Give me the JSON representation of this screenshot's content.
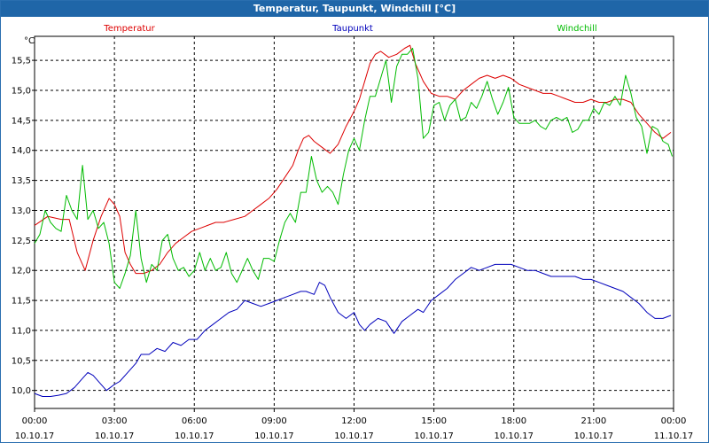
{
  "window": {
    "title": "Temperatur, Taupunkt, Windchill [°C]"
  },
  "chart_data": {
    "type": "line",
    "title": "Temperatur, Taupunkt, Windchill [°C]",
    "ylabel": "°C",
    "ylim": [
      9.7,
      15.9
    ],
    "yticks": [
      "10,0",
      "10,5",
      "11,0",
      "11,5",
      "12,0",
      "12,5",
      "13,0",
      "13,5",
      "14,0",
      "14,5",
      "15,0",
      "15,5"
    ],
    "xlim": [
      0,
      24
    ],
    "xticks": [
      {
        "time": "00:00",
        "date": "10.10.17"
      },
      {
        "time": "03:00",
        "date": "10.10.17"
      },
      {
        "time": "06:00",
        "date": "10.10.17"
      },
      {
        "time": "09:00",
        "date": "10.10.17"
      },
      {
        "time": "12:00",
        "date": "10.10.17"
      },
      {
        "time": "15:00",
        "date": "10.10.17"
      },
      {
        "time": "18:00",
        "date": "10.10.17"
      },
      {
        "time": "21:00",
        "date": "10.10.17"
      },
      {
        "time": "00:00",
        "date": "11.10.17"
      }
    ],
    "grid": true,
    "legend_position": "top",
    "series": [
      {
        "name": "Temperatur",
        "color": "#dd0000",
        "points": [
          [
            0,
            12.75
          ],
          [
            0.5,
            12.9
          ],
          [
            1,
            12.85
          ],
          [
            1.3,
            12.85
          ],
          [
            1.6,
            12.3
          ],
          [
            1.9,
            12.0
          ],
          [
            2.2,
            12.5
          ],
          [
            2.5,
            12.9
          ],
          [
            2.8,
            13.2
          ],
          [
            3.0,
            13.1
          ],
          [
            3.2,
            12.9
          ],
          [
            3.4,
            12.3
          ],
          [
            3.6,
            12.1
          ],
          [
            3.8,
            11.95
          ],
          [
            4.1,
            11.95
          ],
          [
            4.4,
            12.0
          ],
          [
            4.7,
            12.1
          ],
          [
            5.0,
            12.3
          ],
          [
            5.3,
            12.45
          ],
          [
            5.6,
            12.55
          ],
          [
            5.9,
            12.65
          ],
          [
            6.2,
            12.7
          ],
          [
            6.5,
            12.75
          ],
          [
            6.8,
            12.8
          ],
          [
            7.1,
            12.8
          ],
          [
            7.5,
            12.85
          ],
          [
            7.9,
            12.9
          ],
          [
            8.2,
            13.0
          ],
          [
            8.5,
            13.1
          ],
          [
            8.8,
            13.2
          ],
          [
            9.1,
            13.35
          ],
          [
            9.4,
            13.55
          ],
          [
            9.7,
            13.75
          ],
          [
            9.9,
            14.0
          ],
          [
            10.1,
            14.2
          ],
          [
            10.3,
            14.25
          ],
          [
            10.5,
            14.15
          ],
          [
            10.8,
            14.05
          ],
          [
            11.1,
            13.95
          ],
          [
            11.4,
            14.1
          ],
          [
            11.7,
            14.4
          ],
          [
            12.0,
            14.65
          ],
          [
            12.2,
            14.85
          ],
          [
            12.4,
            15.15
          ],
          [
            12.6,
            15.45
          ],
          [
            12.8,
            15.6
          ],
          [
            13.0,
            15.65
          ],
          [
            13.3,
            15.55
          ],
          [
            13.6,
            15.6
          ],
          [
            13.9,
            15.7
          ],
          [
            14.1,
            15.75
          ],
          [
            14.3,
            15.45
          ],
          [
            14.6,
            15.15
          ],
          [
            14.9,
            14.95
          ],
          [
            15.2,
            14.9
          ],
          [
            15.5,
            14.9
          ],
          [
            15.8,
            14.85
          ],
          [
            16.1,
            15.0
          ],
          [
            16.4,
            15.1
          ],
          [
            16.7,
            15.2
          ],
          [
            17.0,
            15.25
          ],
          [
            17.3,
            15.2
          ],
          [
            17.6,
            15.25
          ],
          [
            17.9,
            15.2
          ],
          [
            18.2,
            15.1
          ],
          [
            18.5,
            15.05
          ],
          [
            18.8,
            15.0
          ],
          [
            19.1,
            14.95
          ],
          [
            19.4,
            14.95
          ],
          [
            19.7,
            14.9
          ],
          [
            20.0,
            14.85
          ],
          [
            20.3,
            14.8
          ],
          [
            20.6,
            14.8
          ],
          [
            20.9,
            14.85
          ],
          [
            21.2,
            14.8
          ],
          [
            21.5,
            14.8
          ],
          [
            21.8,
            14.85
          ],
          [
            22.1,
            14.85
          ],
          [
            22.4,
            14.8
          ],
          [
            22.7,
            14.6
          ],
          [
            23.0,
            14.45
          ],
          [
            23.3,
            14.3
          ],
          [
            23.6,
            14.2
          ],
          [
            23.9,
            14.3
          ]
        ]
      },
      {
        "name": "Taupunkt",
        "color": "#0000bb",
        "points": [
          [
            0,
            9.95
          ],
          [
            0.3,
            9.9
          ],
          [
            0.6,
            9.9
          ],
          [
            0.9,
            9.92
          ],
          [
            1.2,
            9.95
          ],
          [
            1.5,
            10.05
          ],
          [
            1.8,
            10.2
          ],
          [
            2.0,
            10.3
          ],
          [
            2.2,
            10.25
          ],
          [
            2.5,
            10.1
          ],
          [
            2.7,
            10.0
          ],
          [
            3.0,
            10.1
          ],
          [
            3.2,
            10.15
          ],
          [
            3.5,
            10.3
          ],
          [
            3.8,
            10.45
          ],
          [
            4.0,
            10.6
          ],
          [
            4.3,
            10.6
          ],
          [
            4.6,
            10.7
          ],
          [
            4.9,
            10.65
          ],
          [
            5.2,
            10.8
          ],
          [
            5.5,
            10.75
          ],
          [
            5.8,
            10.85
          ],
          [
            6.1,
            10.85
          ],
          [
            6.4,
            11.0
          ],
          [
            6.7,
            11.1
          ],
          [
            7.0,
            11.2
          ],
          [
            7.3,
            11.3
          ],
          [
            7.6,
            11.35
          ],
          [
            7.9,
            11.5
          ],
          [
            8.2,
            11.45
          ],
          [
            8.5,
            11.4
          ],
          [
            8.8,
            11.45
          ],
          [
            9.1,
            11.5
          ],
          [
            9.4,
            11.55
          ],
          [
            9.7,
            11.6
          ],
          [
            10.0,
            11.65
          ],
          [
            10.2,
            11.65
          ],
          [
            10.5,
            11.6
          ],
          [
            10.7,
            11.8
          ],
          [
            10.9,
            11.75
          ],
          [
            11.1,
            11.55
          ],
          [
            11.4,
            11.3
          ],
          [
            11.7,
            11.2
          ],
          [
            12.0,
            11.3
          ],
          [
            12.2,
            11.1
          ],
          [
            12.4,
            11.0
          ],
          [
            12.6,
            11.1
          ],
          [
            12.9,
            11.2
          ],
          [
            13.2,
            11.15
          ],
          [
            13.5,
            10.95
          ],
          [
            13.8,
            11.15
          ],
          [
            14.1,
            11.25
          ],
          [
            14.4,
            11.35
          ],
          [
            14.6,
            11.3
          ],
          [
            14.9,
            11.5
          ],
          [
            15.2,
            11.6
          ],
          [
            15.5,
            11.7
          ],
          [
            15.8,
            11.85
          ],
          [
            16.1,
            11.95
          ],
          [
            16.4,
            12.05
          ],
          [
            16.7,
            12.0
          ],
          [
            17.0,
            12.05
          ],
          [
            17.3,
            12.1
          ],
          [
            17.6,
            12.1
          ],
          [
            17.9,
            12.1
          ],
          [
            18.2,
            12.05
          ],
          [
            18.5,
            12.0
          ],
          [
            18.8,
            12.0
          ],
          [
            19.1,
            11.95
          ],
          [
            19.4,
            11.9
          ],
          [
            19.7,
            11.9
          ],
          [
            20.0,
            11.9
          ],
          [
            20.3,
            11.9
          ],
          [
            20.6,
            11.85
          ],
          [
            20.9,
            11.85
          ],
          [
            21.2,
            11.8
          ],
          [
            21.5,
            11.75
          ],
          [
            21.8,
            11.7
          ],
          [
            22.1,
            11.65
          ],
          [
            22.4,
            11.55
          ],
          [
            22.7,
            11.45
          ],
          [
            23.0,
            11.3
          ],
          [
            23.3,
            11.2
          ],
          [
            23.6,
            11.2
          ],
          [
            23.9,
            11.25
          ]
        ]
      },
      {
        "name": "Windchill",
        "color": "#00bb00",
        "points": [
          [
            0,
            12.45
          ],
          [
            0.2,
            12.6
          ],
          [
            0.4,
            13.0
          ],
          [
            0.6,
            12.8
          ],
          [
            0.8,
            12.7
          ],
          [
            1.0,
            12.65
          ],
          [
            1.2,
            13.25
          ],
          [
            1.4,
            13.0
          ],
          [
            1.6,
            12.85
          ],
          [
            1.8,
            13.75
          ],
          [
            2.0,
            12.85
          ],
          [
            2.2,
            13.0
          ],
          [
            2.4,
            12.7
          ],
          [
            2.6,
            12.8
          ],
          [
            2.8,
            12.45
          ],
          [
            3.0,
            11.8
          ],
          [
            3.2,
            11.7
          ],
          [
            3.4,
            11.95
          ],
          [
            3.6,
            12.25
          ],
          [
            3.8,
            13.0
          ],
          [
            4.0,
            12.2
          ],
          [
            4.2,
            11.8
          ],
          [
            4.4,
            12.1
          ],
          [
            4.6,
            12.0
          ],
          [
            4.8,
            12.5
          ],
          [
            5.0,
            12.6
          ],
          [
            5.2,
            12.2
          ],
          [
            5.4,
            12.0
          ],
          [
            5.6,
            12.05
          ],
          [
            5.8,
            11.9
          ],
          [
            6.0,
            12.0
          ],
          [
            6.2,
            12.3
          ],
          [
            6.4,
            12.0
          ],
          [
            6.6,
            12.2
          ],
          [
            6.8,
            12.0
          ],
          [
            7.0,
            12.05
          ],
          [
            7.2,
            12.3
          ],
          [
            7.4,
            11.95
          ],
          [
            7.6,
            11.8
          ],
          [
            7.8,
            12.0
          ],
          [
            8.0,
            12.2
          ],
          [
            8.2,
            12.0
          ],
          [
            8.4,
            11.85
          ],
          [
            8.6,
            12.2
          ],
          [
            8.8,
            12.2
          ],
          [
            9.0,
            12.15
          ],
          [
            9.2,
            12.5
          ],
          [
            9.4,
            12.8
          ],
          [
            9.6,
            12.95
          ],
          [
            9.8,
            12.8
          ],
          [
            10.0,
            13.3
          ],
          [
            10.2,
            13.3
          ],
          [
            10.4,
            13.9
          ],
          [
            10.6,
            13.5
          ],
          [
            10.8,
            13.3
          ],
          [
            11.0,
            13.4
          ],
          [
            11.2,
            13.3
          ],
          [
            11.4,
            13.1
          ],
          [
            11.6,
            13.6
          ],
          [
            11.8,
            14.0
          ],
          [
            12.0,
            14.2
          ],
          [
            12.2,
            14.0
          ],
          [
            12.4,
            14.5
          ],
          [
            12.6,
            14.9
          ],
          [
            12.8,
            14.9
          ],
          [
            13.0,
            15.2
          ],
          [
            13.2,
            15.5
          ],
          [
            13.4,
            14.8
          ],
          [
            13.6,
            15.4
          ],
          [
            13.8,
            15.6
          ],
          [
            14.0,
            15.6
          ],
          [
            14.2,
            15.7
          ],
          [
            14.4,
            15.2
          ],
          [
            14.6,
            14.2
          ],
          [
            14.8,
            14.3
          ],
          [
            15.0,
            14.75
          ],
          [
            15.2,
            14.8
          ],
          [
            15.4,
            14.5
          ],
          [
            15.6,
            14.75
          ],
          [
            15.8,
            14.85
          ],
          [
            16.0,
            14.5
          ],
          [
            16.2,
            14.55
          ],
          [
            16.4,
            14.8
          ],
          [
            16.6,
            14.7
          ],
          [
            16.8,
            14.9
          ],
          [
            17.0,
            15.15
          ],
          [
            17.2,
            14.85
          ],
          [
            17.4,
            14.6
          ],
          [
            17.6,
            14.8
          ],
          [
            17.8,
            15.05
          ],
          [
            18.0,
            14.55
          ],
          [
            18.2,
            14.45
          ],
          [
            18.4,
            14.45
          ],
          [
            18.6,
            14.45
          ],
          [
            18.8,
            14.5
          ],
          [
            19.0,
            14.4
          ],
          [
            19.2,
            14.35
          ],
          [
            19.4,
            14.5
          ],
          [
            19.6,
            14.55
          ],
          [
            19.8,
            14.5
          ],
          [
            20.0,
            14.55
          ],
          [
            20.2,
            14.3
          ],
          [
            20.4,
            14.35
          ],
          [
            20.6,
            14.5
          ],
          [
            20.8,
            14.5
          ],
          [
            21.0,
            14.7
          ],
          [
            21.2,
            14.6
          ],
          [
            21.4,
            14.8
          ],
          [
            21.6,
            14.75
          ],
          [
            21.8,
            14.9
          ],
          [
            22.0,
            14.75
          ],
          [
            22.2,
            15.25
          ],
          [
            22.4,
            14.95
          ],
          [
            22.6,
            14.55
          ],
          [
            22.8,
            14.4
          ],
          [
            23.0,
            13.95
          ],
          [
            23.2,
            14.4
          ],
          [
            23.4,
            14.35
          ],
          [
            23.6,
            14.15
          ],
          [
            23.8,
            14.1
          ],
          [
            23.95,
            13.9
          ]
        ]
      }
    ]
  }
}
